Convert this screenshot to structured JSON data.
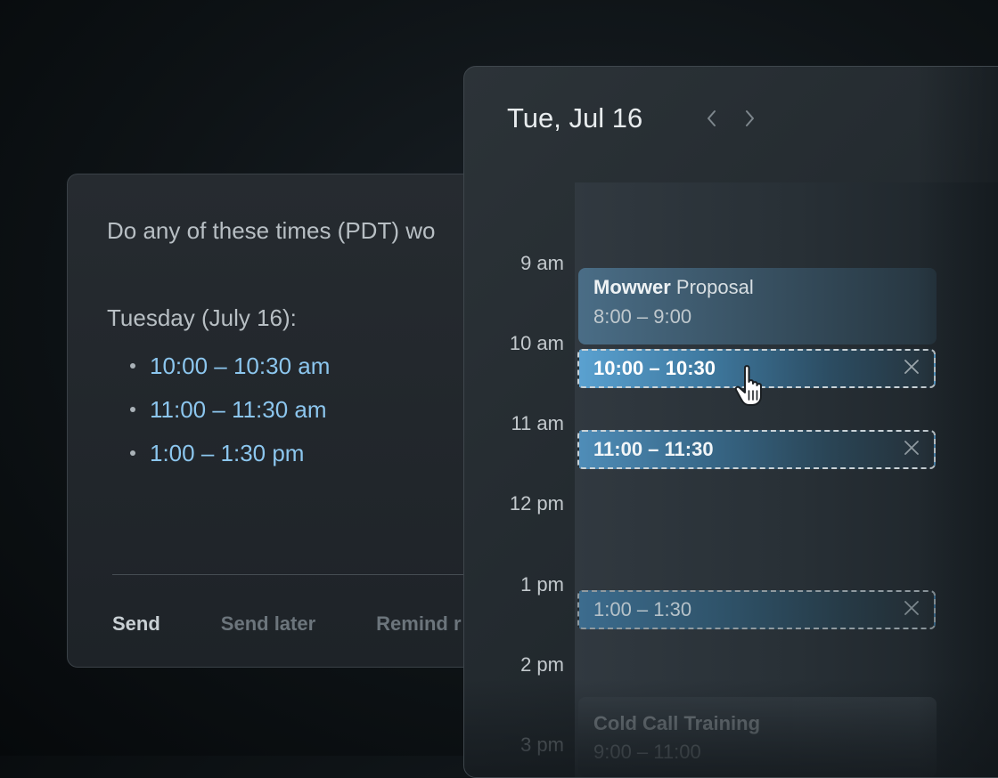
{
  "compose": {
    "question": "Do any of these times (PDT) wo",
    "day_label": "Tuesday (July 16):",
    "options": [
      "10:00 – 10:30 am",
      "11:00 – 11:30 am",
      "1:00 – 1:30 pm"
    ],
    "actions": {
      "send": "Send",
      "send_later": "Send later",
      "remind": "Remind r"
    }
  },
  "calendar": {
    "date": "Tue, Jul 16",
    "hours": [
      "9 am",
      "10 am",
      "11 am",
      "12 pm",
      "1 pm",
      "2 pm",
      "3 pm"
    ],
    "events": {
      "proposal": {
        "title_bold": "Mowwer",
        "title_rest": " Proposal",
        "time": "8:00 – 9:00"
      },
      "slot1": "10:00 – 10:30",
      "slot2": "11:00 – 11:30",
      "slot3": "1:00 – 1:30",
      "training": {
        "title": "Cold Call Training",
        "time": "9:00 – 11:00"
      }
    },
    "icons": {
      "prev": "chevron-left-icon",
      "next": "chevron-right-icon",
      "remove": "close-icon",
      "pointer": "hand-pointer-icon"
    }
  },
  "colors": {
    "accent": "#8cc6ee",
    "selected_slot": "#5aa1d0"
  }
}
